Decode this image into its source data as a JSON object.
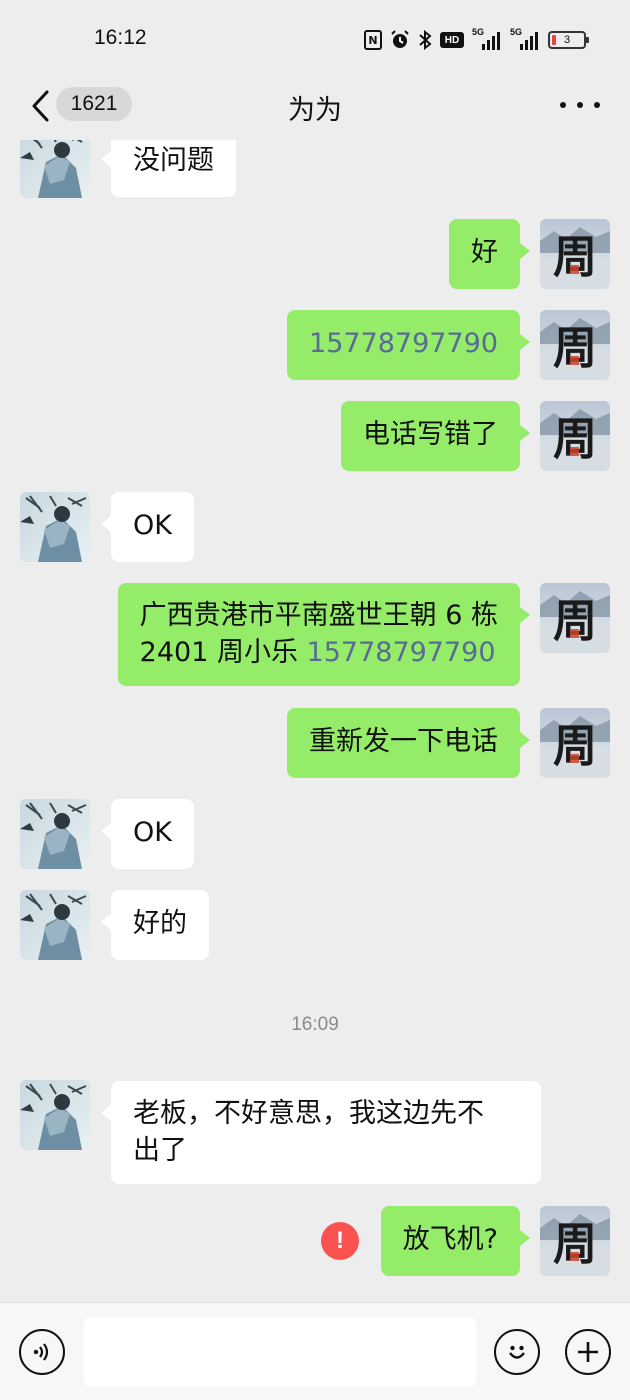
{
  "status_bar": {
    "time": "16:12",
    "network": "5G",
    "battery": "3"
  },
  "nav": {
    "unread_count": "1621",
    "title": "为为"
  },
  "messages": [
    {
      "from": "other",
      "text": "没问题"
    },
    {
      "from": "me",
      "text": "好"
    },
    {
      "from": "me",
      "text": "15778797790"
    },
    {
      "from": "me",
      "text": "电话写错了"
    },
    {
      "from": "other",
      "text": "OK"
    },
    {
      "from": "me",
      "line1": "广西贵港市平南盛世王朝 6 栋",
      "line2_prefix": "2401 周小乐 ",
      "phone": "15778797790"
    },
    {
      "from": "me",
      "text": "重新发一下电话"
    },
    {
      "from": "other",
      "text": "OK"
    },
    {
      "from": "other",
      "text": "好的"
    },
    {
      "from": "other",
      "line1": "老板，不好意思，我这边先不",
      "line2": "出了"
    },
    {
      "from": "me",
      "text": "放飞机?",
      "failed": true
    }
  ],
  "time_separator": "16:09",
  "avatars": {
    "me_glyph": "周"
  },
  "colors": {
    "my_bubble": "#95ec69",
    "other_bubble": "#ffffff",
    "background": "#ededed",
    "link": "#576b95",
    "error": "#fa5151"
  },
  "icons": [
    "back-chevron-icon",
    "more-icon",
    "voice-icon",
    "emoji-icon",
    "plus-icon",
    "error-icon",
    "nfc-icon",
    "alarm-icon",
    "bluetooth-icon",
    "hd-icon",
    "signal-icon",
    "battery-icon"
  ]
}
